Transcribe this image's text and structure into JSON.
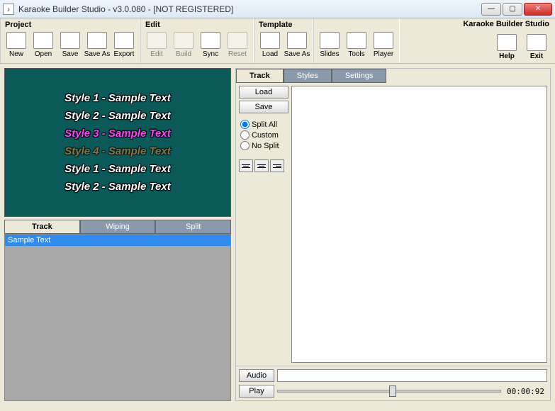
{
  "window": {
    "title": "Karaoke Builder Studio - v3.0.080 - [NOT REGISTERED]"
  },
  "brand": "Karaoke Builder Studio",
  "toolbar": {
    "project": {
      "title": "Project",
      "new": "New",
      "open": "Open",
      "save": "Save",
      "saveas": "Save As",
      "export": "Export"
    },
    "edit": {
      "title": "Edit",
      "edit": "Edit",
      "build": "Build",
      "sync": "Sync",
      "reset": "Reset"
    },
    "template": {
      "title": "Template",
      "load": "Load",
      "saveas": "Save As"
    },
    "extra": {
      "slides": "Slides",
      "tools": "Tools",
      "player": "Player"
    },
    "help": {
      "help": "Help",
      "exit": "Exit"
    }
  },
  "preview": {
    "lines": [
      "Style 1 - Sample Text",
      "Style 2 - Sample Text",
      "Style 3 - Sample Text",
      "Style 4 - Sample Text",
      "Style 1 - Sample Text",
      "Style 2 - Sample Text"
    ]
  },
  "left_tabs": {
    "track": "Track",
    "wiping": "Wiping",
    "split": "Split"
  },
  "tracklist": {
    "row0": "Sample Text"
  },
  "right_tabs": {
    "track": "Track",
    "styles": "Styles",
    "settings": "Settings"
  },
  "rside": {
    "load": "Load",
    "save": "Save",
    "splitall": "Split All",
    "custom": "Custom",
    "nosplit": "No Split"
  },
  "bottom": {
    "audio": "Audio",
    "play": "Play",
    "time": "00:00:92"
  }
}
